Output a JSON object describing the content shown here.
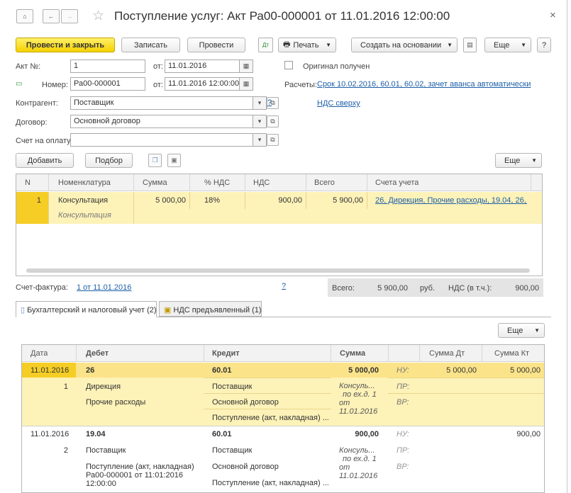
{
  "window": {
    "title": "Поступление услуг: Акт Ра00-000001 от 11.01.2016 12:00:00",
    "close": "×"
  },
  "toolbar": {
    "post_close": "Провести и закрыть",
    "save": "Записать",
    "post": "Провести",
    "print": "Печать",
    "create_based": "Создать на основании",
    "more": "Еще",
    "help": "?"
  },
  "form": {
    "act_label": "Акт №:",
    "act_value": "1",
    "date_label1": "от:",
    "date_value1": "11.01.2016",
    "original_label": "Оригинал получен",
    "number_label": "Номер:",
    "number_value": "Ра00-000001",
    "date_label2": "от:",
    "date_value2": "11.01.2016 12:00:00",
    "payments_label": "Расчеты:",
    "payments_link": "Срок 10.02.2016, 60.01, 60.02, зачет аванса автоматически",
    "counterparty_label": "Контрагент:",
    "counterparty_value": "Поставщик",
    "help_q": "?",
    "vat_link": "НДС сверху",
    "contract_label": "Договор:",
    "contract_value": "Основной договор",
    "invoice_label": "Счет на оплату:",
    "invoice_value": ""
  },
  "goods": {
    "add": "Добавить",
    "select": "Подбор",
    "more": "Еще",
    "columns": [
      "N",
      "Номенклатура",
      "Сумма",
      "% НДС",
      "НДС",
      "Всего",
      "Счета учета"
    ],
    "rows": [
      {
        "n": "1",
        "item": "Консультация",
        "item_sub": "Консультация",
        "sum": "5 000,00",
        "vat_rate": "18%",
        "vat": "900,00",
        "total": "5 900,00",
        "accounts": "26, Дирекция, Прочие расходы, 19.04, 26, ..."
      }
    ]
  },
  "footer": {
    "invoice_label": "Счет-фактура:",
    "invoice_link": "1 от 11.01.2016",
    "help_q": "?",
    "total_label": "Всего:",
    "total_value": "5 900,00",
    "currency": "руб.",
    "vat_incl_label": "НДС (в т.ч.):",
    "vat_incl_value": "900,00"
  },
  "tabs": [
    {
      "label": "Бухгалтерский и налоговый учет (2)"
    },
    {
      "label": "НДС предъявленный (1)"
    }
  ],
  "entries": {
    "more": "Еще",
    "columns": [
      "Дата",
      "Дебет",
      "Кредит",
      "Сумма",
      "",
      "Сумма Дт",
      "Сумма Кт"
    ],
    "rows": [
      {
        "date": "11.01.2016",
        "n": "1",
        "debit": [
          "26",
          "Дирекция",
          "Прочие расходы"
        ],
        "credit": [
          "60.01",
          "Поставщик",
          "Основной договор",
          "Поступление (акт, накладная) ..."
        ],
        "sum": "5 000,00",
        "sum_note": [
          "Консуль...",
          "по ех.д. 1",
          "от",
          "11.01.2016"
        ],
        "kinds": [
          "НУ:",
          "ПР:",
          "ВР:"
        ],
        "sum_dt": "5 000,00",
        "sum_kt": "5 000,00"
      },
      {
        "date": "11.01.2016",
        "n": "2",
        "debit": [
          "19.04",
          "Поставщик",
          "Поступление (акт, накладная)",
          "Ра00-000001 от 11:01:2016",
          "12:00:00"
        ],
        "credit": [
          "60.01",
          "Поставщик",
          "Основной договор",
          "Поступление (акт, накладная) ..."
        ],
        "sum": "900,00",
        "sum_note": [
          "Консуль...",
          "по ех.д. 1",
          "от",
          "11.01.2016"
        ],
        "kinds": [
          "НУ:",
          "ПР:",
          "ВР:"
        ],
        "sum_dt": "",
        "sum_kt": "900,00"
      }
    ]
  }
}
